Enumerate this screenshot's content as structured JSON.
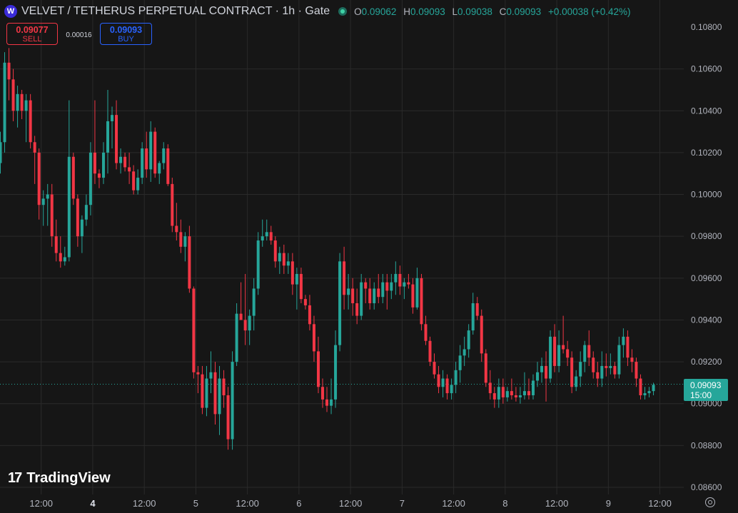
{
  "header": {
    "symbol_icon": "velvet-logo-icon",
    "title": "VELVET / TETHERUS PERPETUAL CONTRACT · 1h · Gate",
    "status_icon": "market-open-icon",
    "o_label": "O",
    "o_value": "0.09062",
    "h_label": "H",
    "h_value": "0.09093",
    "l_label": "L",
    "l_value": "0.09038",
    "c_label": "C",
    "c_value": "0.09093",
    "change": "+0.00038 (+0.42%)"
  },
  "trade": {
    "sell_price": "0.09077",
    "sell_label": "SELL",
    "spread": "0.00016",
    "buy_price": "0.09093",
    "buy_label": "BUY"
  },
  "branding": {
    "logo_mark": "17",
    "logo_text": "TradingView"
  },
  "price_tag": {
    "price": "0.09093",
    "countdown": "15:00"
  },
  "colors": {
    "up": "#26a69a",
    "down": "#f23645",
    "grid": "#2a2a2a",
    "background": "#161616"
  },
  "chart_data": {
    "type": "candlestick",
    "y_ticks": [
      0.106,
      0.104,
      0.102,
      0.1,
      0.098,
      0.096,
      0.094,
      0.092,
      0.09,
      0.088,
      0.086
    ],
    "y_tick_labels": [
      "0.10600",
      "0.10400",
      "0.10200",
      "0.10000",
      "0.09800",
      "0.09600",
      "0.09400",
      "0.09200",
      "0.09000",
      "0.08800",
      "0.08600"
    ],
    "extra_y_labels": [
      {
        "value": 0.108,
        "label": "0.10800"
      }
    ],
    "ylim": [
      0.0855,
      0.1088
    ],
    "x_ticks": [
      {
        "label": "12:00",
        "index": 9.5,
        "bold": false
      },
      {
        "label": "4",
        "index": 21.5,
        "bold": true
      },
      {
        "label": "12:00",
        "index": 33.5,
        "bold": false
      },
      {
        "label": "5",
        "index": 45.5,
        "bold": false
      },
      {
        "label": "12:00",
        "index": 57.5,
        "bold": false
      },
      {
        "label": "6",
        "index": 69.5,
        "bold": false
      },
      {
        "label": "12:00",
        "index": 81.5,
        "bold": false
      },
      {
        "label": "7",
        "index": 93.5,
        "bold": false
      },
      {
        "label": "12:00",
        "index": 105.5,
        "bold": false
      },
      {
        "label": "8",
        "index": 117.5,
        "bold": false
      },
      {
        "label": "12:00",
        "index": 129.5,
        "bold": false
      },
      {
        "label": "9",
        "index": 141.5,
        "bold": false
      },
      {
        "label": "12:00",
        "index": 153.5,
        "bold": false
      }
    ],
    "last_price": 0.09093,
    "candles": [
      [
        0.1015,
        0.103,
        0.101,
        0.1025
      ],
      [
        0.1025,
        0.1068,
        0.102,
        0.1063
      ],
      [
        0.1063,
        0.107,
        0.1045,
        0.1055
      ],
      [
        0.1055,
        0.106,
        0.1035,
        0.104
      ],
      [
        0.104,
        0.1052,
        0.1032,
        0.1048
      ],
      [
        0.1048,
        0.105,
        0.1036,
        0.104
      ],
      [
        0.104,
        0.1048,
        0.1025,
        0.1045
      ],
      [
        0.1045,
        0.1048,
        0.1022,
        0.1025
      ],
      [
        0.1025,
        0.1028,
        0.1005,
        0.102
      ],
      [
        0.102,
        0.1022,
        0.0988,
        0.0995
      ],
      [
        0.0995,
        0.1002,
        0.0985,
        0.0998
      ],
      [
        0.0998,
        0.1005,
        0.0985,
        0.1
      ],
      [
        0.1,
        0.1005,
        0.0975,
        0.098
      ],
      [
        0.098,
        0.0988,
        0.0968,
        0.0972
      ],
      [
        0.0972,
        0.098,
        0.0965,
        0.0968
      ],
      [
        0.0968,
        0.0975,
        0.0966,
        0.097
      ],
      [
        0.097,
        0.1045,
        0.0968,
        0.1018
      ],
      [
        0.1018,
        0.102,
        0.0995,
        0.0998
      ],
      [
        0.0998,
        0.1,
        0.0975,
        0.098
      ],
      [
        0.098,
        0.099,
        0.0972,
        0.0988
      ],
      [
        0.0988,
        0.1,
        0.0985,
        0.0995
      ],
      [
        0.0995,
        0.1025,
        0.099,
        0.102
      ],
      [
        0.102,
        0.1045,
        0.1005,
        0.101
      ],
      [
        0.101,
        0.1012,
        0.1003,
        0.1008
      ],
      [
        0.1008,
        0.1025,
        0.1005,
        0.102
      ],
      [
        0.102,
        0.105,
        0.101,
        0.1035
      ],
      [
        0.1035,
        0.1042,
        0.1022,
        0.1038
      ],
      [
        0.1038,
        0.1045,
        0.1012,
        0.1015
      ],
      [
        0.1015,
        0.1022,
        0.101,
        0.1018
      ],
      [
        0.1018,
        0.102,
        0.1011,
        0.1013
      ],
      [
        0.1013,
        0.102,
        0.1005,
        0.1011
      ],
      [
        0.1011,
        0.1014,
        0.1,
        0.1002
      ],
      [
        0.1002,
        0.1012,
        0.1,
        0.1008
      ],
      [
        0.1008,
        0.1025,
        0.1005,
        0.1022
      ],
      [
        0.1022,
        0.103,
        0.1008,
        0.1012
      ],
      [
        0.1012,
        0.1035,
        0.1006,
        0.103
      ],
      [
        0.103,
        0.1032,
        0.1008,
        0.101
      ],
      [
        0.101,
        0.1016,
        0.1005,
        0.1015
      ],
      [
        0.1015,
        0.1025,
        0.1012,
        0.1022
      ],
      [
        0.1022,
        0.1024,
        0.1004,
        0.1005
      ],
      [
        0.1005,
        0.1008,
        0.0982,
        0.0985
      ],
      [
        0.0985,
        0.0996,
        0.0978,
        0.0982
      ],
      [
        0.0982,
        0.0988,
        0.0972,
        0.0975
      ],
      [
        0.0975,
        0.0982,
        0.0968,
        0.098
      ],
      [
        0.098,
        0.0985,
        0.0953,
        0.0955
      ],
      [
        0.0955,
        0.0956,
        0.0912,
        0.0915
      ],
      [
        0.0915,
        0.0918,
        0.0905,
        0.0914
      ],
      [
        0.0914,
        0.0918,
        0.0895,
        0.0898
      ],
      [
        0.0898,
        0.0918,
        0.0894,
        0.0912
      ],
      [
        0.0912,
        0.0925,
        0.0905,
        0.0915
      ],
      [
        0.0915,
        0.092,
        0.089,
        0.0895
      ],
      [
        0.0895,
        0.0918,
        0.0885,
        0.0912
      ],
      [
        0.0912,
        0.0916,
        0.0898,
        0.0904
      ],
      [
        0.0904,
        0.0908,
        0.0878,
        0.0883
      ],
      [
        0.0883,
        0.0925,
        0.0878,
        0.092
      ],
      [
        0.092,
        0.0948,
        0.0918,
        0.0943
      ],
      [
        0.0943,
        0.0958,
        0.094,
        0.094
      ],
      [
        0.094,
        0.0962,
        0.0928,
        0.0935
      ],
      [
        0.0935,
        0.0945,
        0.0928,
        0.0942
      ],
      [
        0.0942,
        0.096,
        0.0935,
        0.0955
      ],
      [
        0.0955,
        0.0982,
        0.0952,
        0.0978
      ],
      [
        0.0978,
        0.0988,
        0.0975,
        0.098
      ],
      [
        0.098,
        0.0988,
        0.0978,
        0.0982
      ],
      [
        0.0982,
        0.0985,
        0.0976,
        0.0978
      ],
      [
        0.0978,
        0.098,
        0.0965,
        0.0968
      ],
      [
        0.0968,
        0.0975,
        0.0962,
        0.0972
      ],
      [
        0.0972,
        0.0976,
        0.0962,
        0.0966
      ],
      [
        0.0966,
        0.0972,
        0.0962,
        0.0968
      ],
      [
        0.0968,
        0.0972,
        0.0952,
        0.0957
      ],
      [
        0.0957,
        0.0965,
        0.0945,
        0.0962
      ],
      [
        0.0962,
        0.0965,
        0.0948,
        0.095
      ],
      [
        0.095,
        0.0952,
        0.0945,
        0.0947
      ],
      [
        0.0947,
        0.0952,
        0.0935,
        0.0938
      ],
      [
        0.0938,
        0.0942,
        0.092,
        0.0925
      ],
      [
        0.0925,
        0.0932,
        0.0905,
        0.0908
      ],
      [
        0.0908,
        0.0912,
        0.0898,
        0.0902
      ],
      [
        0.0902,
        0.0908,
        0.0896,
        0.0899
      ],
      [
        0.0899,
        0.0912,
        0.0895,
        0.0902
      ],
      [
        0.0902,
        0.0935,
        0.0898,
        0.0928
      ],
      [
        0.0928,
        0.0972,
        0.0925,
        0.0968
      ],
      [
        0.0968,
        0.0975,
        0.0945,
        0.0952
      ],
      [
        0.0952,
        0.0962,
        0.0945,
        0.0955
      ],
      [
        0.0955,
        0.096,
        0.0942,
        0.0948
      ],
      [
        0.0948,
        0.0955,
        0.0938,
        0.0942
      ],
      [
        0.0942,
        0.0962,
        0.094,
        0.0958
      ],
      [
        0.0958,
        0.096,
        0.0948,
        0.0955
      ],
      [
        0.0955,
        0.096,
        0.0945,
        0.0948
      ],
      [
        0.0948,
        0.0958,
        0.0945,
        0.0955
      ],
      [
        0.0955,
        0.0962,
        0.0948,
        0.0951
      ],
      [
        0.0951,
        0.0962,
        0.0948,
        0.0958
      ],
      [
        0.0958,
        0.0962,
        0.0945,
        0.0954
      ],
      [
        0.0954,
        0.0962,
        0.095,
        0.0958
      ],
      [
        0.0958,
        0.0968,
        0.0952,
        0.0962
      ],
      [
        0.0962,
        0.0966,
        0.0952,
        0.0956
      ],
      [
        0.0956,
        0.096,
        0.095,
        0.0958
      ],
      [
        0.0958,
        0.0962,
        0.0955,
        0.0957
      ],
      [
        0.0957,
        0.096,
        0.0943,
        0.0946
      ],
      [
        0.0946,
        0.0965,
        0.0945,
        0.096
      ],
      [
        0.096,
        0.0962,
        0.0935,
        0.0938
      ],
      [
        0.0938,
        0.0942,
        0.0928,
        0.093
      ],
      [
        0.093,
        0.0932,
        0.0918,
        0.092
      ],
      [
        0.092,
        0.0924,
        0.0912,
        0.0914
      ],
      [
        0.0914,
        0.0918,
        0.0905,
        0.0908
      ],
      [
        0.0908,
        0.0916,
        0.0903,
        0.0912
      ],
      [
        0.0912,
        0.0914,
        0.0902,
        0.0905
      ],
      [
        0.0905,
        0.0912,
        0.0902,
        0.0909
      ],
      [
        0.0909,
        0.092,
        0.0905,
        0.0916
      ],
      [
        0.0916,
        0.0928,
        0.091,
        0.0923
      ],
      [
        0.0923,
        0.0932,
        0.0918,
        0.0926
      ],
      [
        0.0926,
        0.0938,
        0.0922,
        0.0935
      ],
      [
        0.0935,
        0.0953,
        0.0933,
        0.0948
      ],
      [
        0.0948,
        0.0951,
        0.094,
        0.0942
      ],
      [
        0.0942,
        0.0945,
        0.092,
        0.0924
      ],
      [
        0.0924,
        0.0926,
        0.0908,
        0.091
      ],
      [
        0.091,
        0.0916,
        0.0902,
        0.0905
      ],
      [
        0.0905,
        0.0908,
        0.0898,
        0.0902
      ],
      [
        0.0902,
        0.0912,
        0.0898,
        0.0908
      ],
      [
        0.0908,
        0.0912,
        0.09,
        0.0903
      ],
      [
        0.0903,
        0.0908,
        0.0901,
        0.0906
      ],
      [
        0.0906,
        0.0912,
        0.0902,
        0.0904
      ],
      [
        0.0904,
        0.0908,
        0.0901,
        0.0903
      ],
      [
        0.0903,
        0.0908,
        0.09,
        0.0904
      ],
      [
        0.0904,
        0.0915,
        0.0902,
        0.0906
      ],
      [
        0.0906,
        0.0912,
        0.0902,
        0.0904
      ],
      [
        0.0904,
        0.0914,
        0.0902,
        0.0911
      ],
      [
        0.0911,
        0.092,
        0.0908,
        0.0915
      ],
      [
        0.0915,
        0.0922,
        0.091,
        0.0918
      ],
      [
        0.0918,
        0.0925,
        0.0901,
        0.0912
      ],
      [
        0.0912,
        0.0935,
        0.091,
        0.0932
      ],
      [
        0.0932,
        0.0938,
        0.0915,
        0.0918
      ],
      [
        0.0918,
        0.0935,
        0.0915,
        0.0928
      ],
      [
        0.0928,
        0.0942,
        0.0924,
        0.0926
      ],
      [
        0.0926,
        0.093,
        0.0918,
        0.0922
      ],
      [
        0.0922,
        0.0925,
        0.0905,
        0.0908
      ],
      [
        0.0908,
        0.0916,
        0.0906,
        0.0913
      ],
      [
        0.0913,
        0.0925,
        0.0908,
        0.092
      ],
      [
        0.092,
        0.093,
        0.0915,
        0.0928
      ],
      [
        0.0928,
        0.0935,
        0.0918,
        0.0922
      ],
      [
        0.0922,
        0.0925,
        0.0912,
        0.0915
      ],
      [
        0.0915,
        0.092,
        0.0908,
        0.0912
      ],
      [
        0.0912,
        0.0925,
        0.0908,
        0.0918
      ],
      [
        0.0918,
        0.0924,
        0.0913,
        0.0917
      ],
      [
        0.0917,
        0.0924,
        0.0914,
        0.0918
      ],
      [
        0.0918,
        0.092,
        0.0912,
        0.0914
      ],
      [
        0.0914,
        0.0932,
        0.0912,
        0.0928
      ],
      [
        0.0928,
        0.0936,
        0.0922,
        0.0932
      ],
      [
        0.0932,
        0.0935,
        0.0918,
        0.0922
      ],
      [
        0.0922,
        0.0926,
        0.0915,
        0.092
      ],
      [
        0.092,
        0.0922,
        0.0908,
        0.0912
      ],
      [
        0.0912,
        0.0914,
        0.0902,
        0.0904
      ],
      [
        0.0904,
        0.0908,
        0.0902,
        0.0905
      ],
      [
        0.0905,
        0.0908,
        0.0903,
        0.0906
      ],
      [
        0.0906,
        0.091,
        0.0904,
        0.0909
      ]
    ]
  }
}
